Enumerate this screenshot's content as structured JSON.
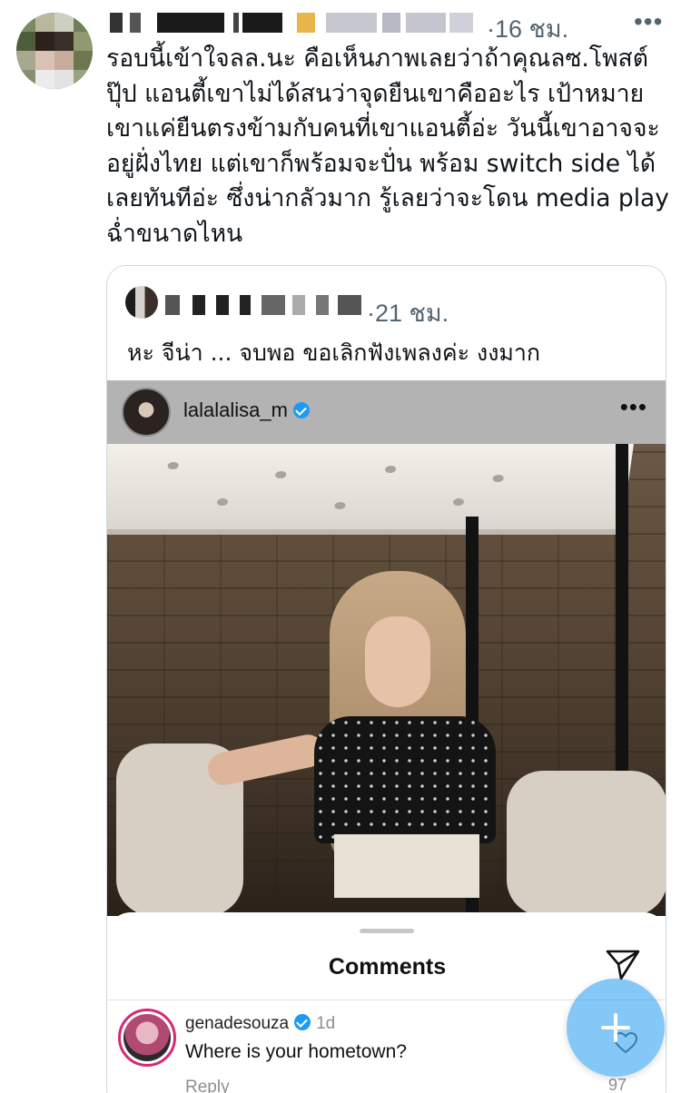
{
  "tweet": {
    "time": "·16 ชม.",
    "more": "•••",
    "text": "รอบนี้เข้าใจลล.นะ คือเห็นภาพเลยว่าถ้าคุณลซ.โพสต์\nปุ๊ป แอนตี้เขาไม่ได้สนว่าจุดยืนเขาคืออะไร เป้าหมาย\nเขาแค่ยืนตรงข้ามกับคนที่เขาแอนตี้อ่ะ วันนี้เขาอาจจะ\nอยู่ฝั่งไทย แต่เขาก็พร้อมจะปั่น พร้อม switch side ได้\nเลยทันทีอ่ะ ซึ่งน่ากลัวมาก รู้เลยว่าจะโดน media play\nฉ่ำขนาดไหน"
  },
  "quote": {
    "time": "·21 ชม.",
    "text": "หะ จีน่า ... จบพอ ขอเลิกฟังเพลงค่ะ งงมาก"
  },
  "instagram": {
    "username": "lalalalisa_m",
    "more": "•••",
    "comments_title": "Comments",
    "comment": {
      "user": "genadesouza",
      "age": "1d",
      "text": "Where is your hometown?",
      "reply": "Reply",
      "likes": "97"
    }
  },
  "colors": {
    "accent": "#1d9bf0",
    "muted": "#536471"
  },
  "icons": {
    "verified": "verified-badge-icon",
    "send": "send-icon",
    "heart": "heart-icon",
    "compose": "plus-icon"
  }
}
